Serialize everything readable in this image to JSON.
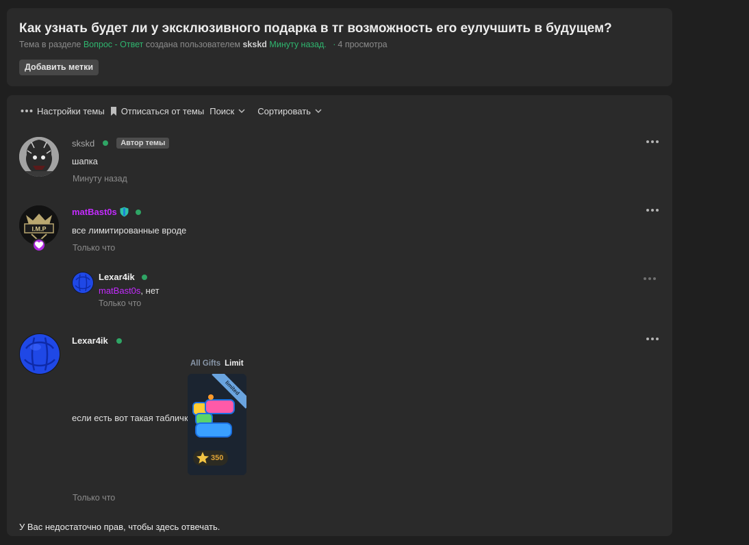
{
  "thread": {
    "title": "Как узнать будет ли у эксклюзивного подарка в тг возможность его еулучшить в будущем?",
    "meta_prefix": "Тема в разделе",
    "section": "Вопрос - Ответ",
    "meta_mid": "создана пользователем",
    "author": "skskd",
    "created": "Минуту назад.",
    "views": "4 просмотра",
    "add_tags_label": "Добавить метки"
  },
  "toolbar": {
    "settings_label": "Настройки темы",
    "unsubscribe_label": "Отписаться от темы",
    "search_label": "Поиск",
    "sort_label": "Сортировать"
  },
  "posts": [
    {
      "username": "skskd",
      "badge": "Автор темы",
      "text": "шапка",
      "time": "Минуту назад"
    },
    {
      "username": "matBast0s",
      "avatar_text": "I.M.P",
      "text": "все лимитированные вроде",
      "time": "Только что"
    },
    {
      "username": "Lexar4ik",
      "mention": "matBast0s",
      "text_suffix": ", нет",
      "time": "Только что"
    },
    {
      "username": "Lexar4ik",
      "text": "если есть вот такая табличка",
      "time": "Только что",
      "gift": {
        "tab_all": "All Gifts",
        "tab_limited": "Limit",
        "ribbon": "limited",
        "price": "350"
      }
    }
  ],
  "footer": {
    "no_rights": "У Вас недостаточно прав, чтобы здесь отвечать."
  },
  "colors": {
    "accent_green": "#2fb66f",
    "purple_name": "#c42bff",
    "background": "#1f1f1f",
    "card": "#2a2a2a"
  }
}
